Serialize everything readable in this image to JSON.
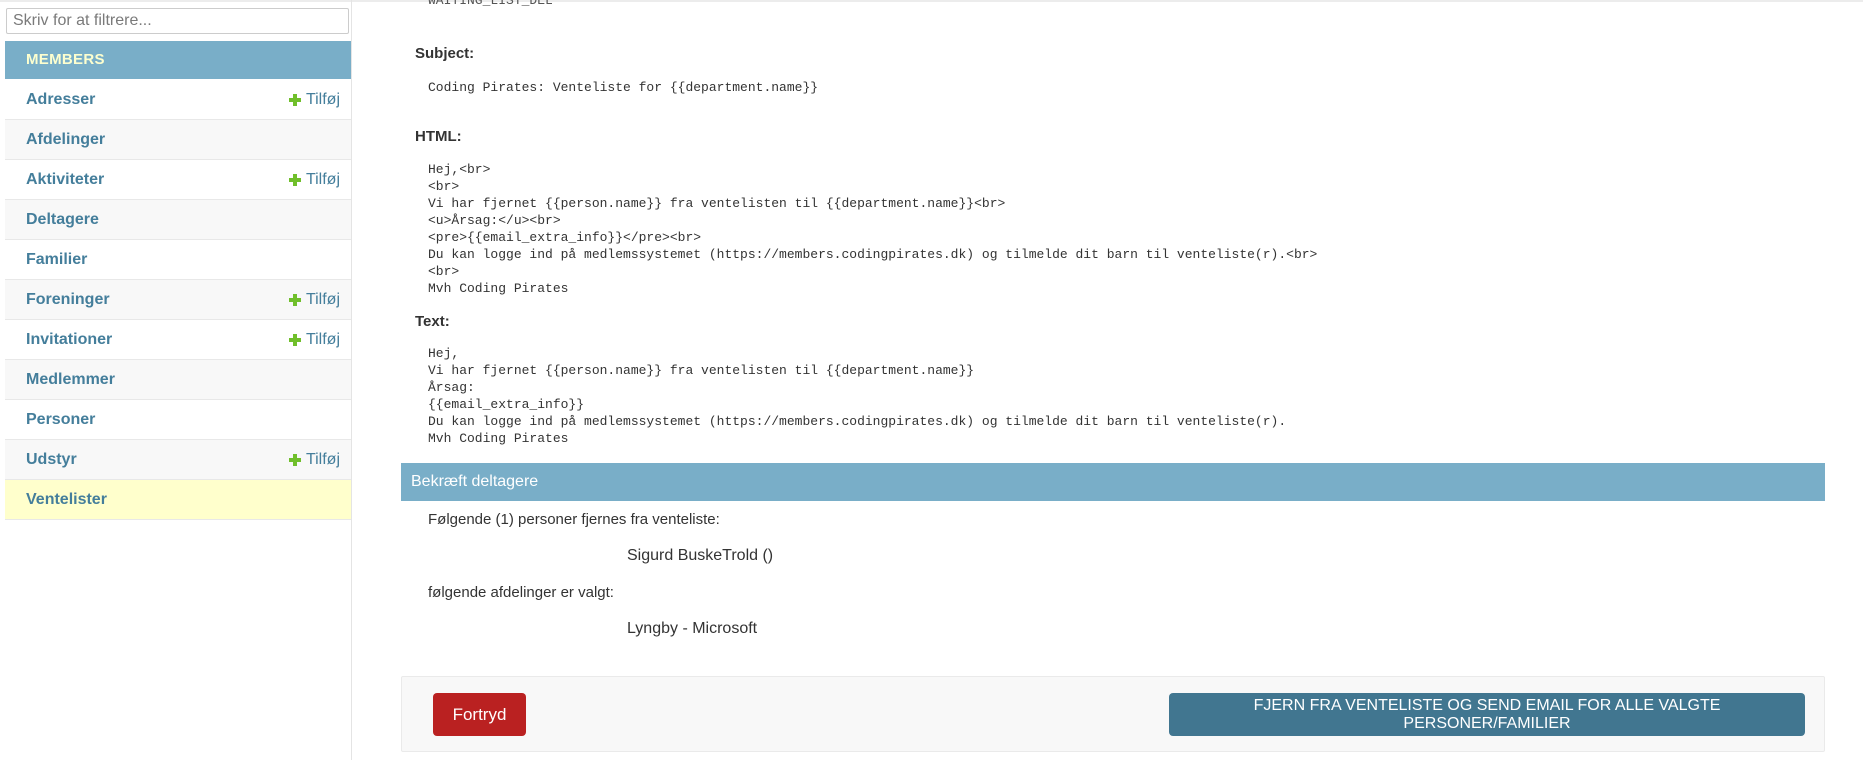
{
  "sidebar": {
    "filter_placeholder": "Skriv for at filtrere...",
    "module_caption": "MEMBERS",
    "add_label": "Tilføj",
    "items": [
      {
        "label": "Adresser"
      },
      {
        "label": "Afdelinger"
      },
      {
        "label": "Aktiviteter"
      },
      {
        "label": "Deltagere"
      },
      {
        "label": "Familier"
      },
      {
        "label": "Foreninger"
      },
      {
        "label": "Invitationer"
      },
      {
        "label": "Medlemmer"
      },
      {
        "label": "Personer"
      },
      {
        "label": "Udstyr"
      },
      {
        "label": "Ventelister"
      }
    ]
  },
  "email": {
    "cut_off_text": "WAITING_LIST_DEL",
    "subject_label": "Subject:",
    "subject_value": "Coding Pirates: Venteliste for {{department.name}}",
    "html_label": "HTML:",
    "html_value": "Hej,<br>\n<br>\nVi har fjernet {{person.name}} fra ventelisten til {{department.name}}<br>\n<u>Årsag:</u><br>\n<pre>{{email_extra_info}}</pre><br>\nDu kan logge ind på medlemssystemet (https://members.codingpirates.dk) og tilmelde dit barn til venteliste(r).<br>\n<br>\nMvh Coding Pirates",
    "text_label": "Text:",
    "text_value": "Hej,\nVi har fjernet {{person.name}} fra ventelisten til {{department.name}}\nÅrsag:\n{{email_extra_info}}\nDu kan logge ind på medlemssystemet (https://members.codingpirates.dk) og tilmelde dit barn til venteliste(r).\nMvh Coding Pirates"
  },
  "confirm": {
    "title": "Bekræft deltagere",
    "persons_label": "Følgende (1) personer fjernes fra venteliste:",
    "person": "Sigurd BuskeTrold ()",
    "departments_label": "følgende afdelinger er valgt:",
    "department": "Lyngby - Microsoft"
  },
  "actions": {
    "cancel_label": "Fortryd",
    "submit_label": "FJERN FRA VENTELISTE OG SEND EMAIL FOR ALLE VALGTE PERSONER/FAMILIER"
  },
  "colors": {
    "header": "#79aec8",
    "link": "#447e9b",
    "add_icon": "#70bf2b",
    "cancel": "#ba2121",
    "submit": "#417690",
    "selected_row": "#ffffcc"
  }
}
